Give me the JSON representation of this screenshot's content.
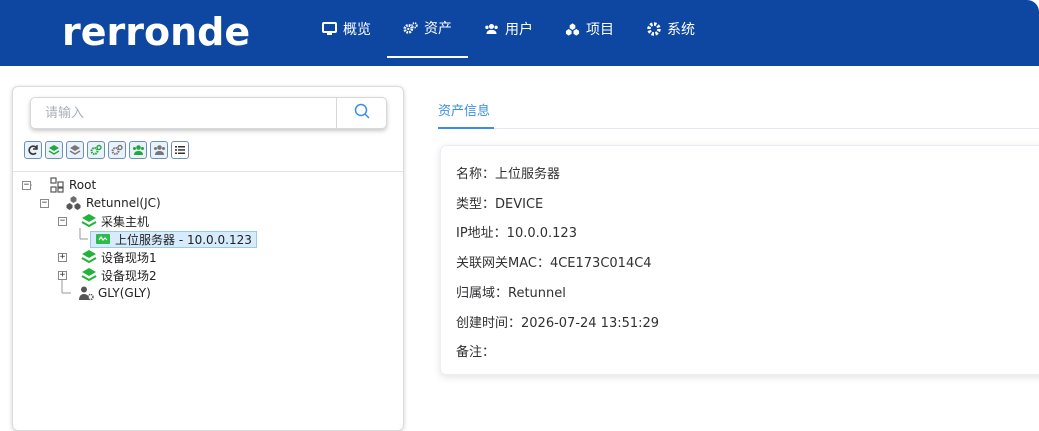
{
  "header": {
    "logo": "rerronde",
    "nav": [
      {
        "label": "概览",
        "icon": "monitor-icon"
      },
      {
        "label": "资产",
        "icon": "cogs-icon"
      },
      {
        "label": "用户",
        "icon": "users-icon"
      },
      {
        "label": "项目",
        "icon": "cubes-icon"
      },
      {
        "label": "系统",
        "icon": "gear-icon"
      }
    ],
    "active_nav": "资产",
    "colors": {
      "bar": "#0d47a1",
      "accent": "#3a8ee6"
    }
  },
  "sidebar": {
    "search_placeholder": "请输入",
    "toolbar": [
      "refresh-icon",
      "layer-green-icon",
      "layer-gray-icon",
      "cogs-green-icon",
      "cogs-gray-icon",
      "users-green-icon",
      "users-gray-icon",
      "list-icon"
    ],
    "tree": {
      "root": "Root",
      "domain": "Retunnel(JC)",
      "collect_host": "采集主机",
      "selected_device": "上位服务器 - 10.0.0.123",
      "site1": "设备现场1",
      "site2": "设备现场2",
      "user": "GLY(GLY)"
    }
  },
  "content": {
    "tab": "资产信息",
    "fields": {
      "name": "名称：上位服务器",
      "type": "类型：DEVICE",
      "ip": "IP地址：10.0.0.123",
      "mac": "关联网关MAC：4CE173C014C4",
      "domain": "归属域：Retunnel",
      "created": "创建时间：2026-07-24 13:51:29",
      "remark": "备注："
    }
  }
}
